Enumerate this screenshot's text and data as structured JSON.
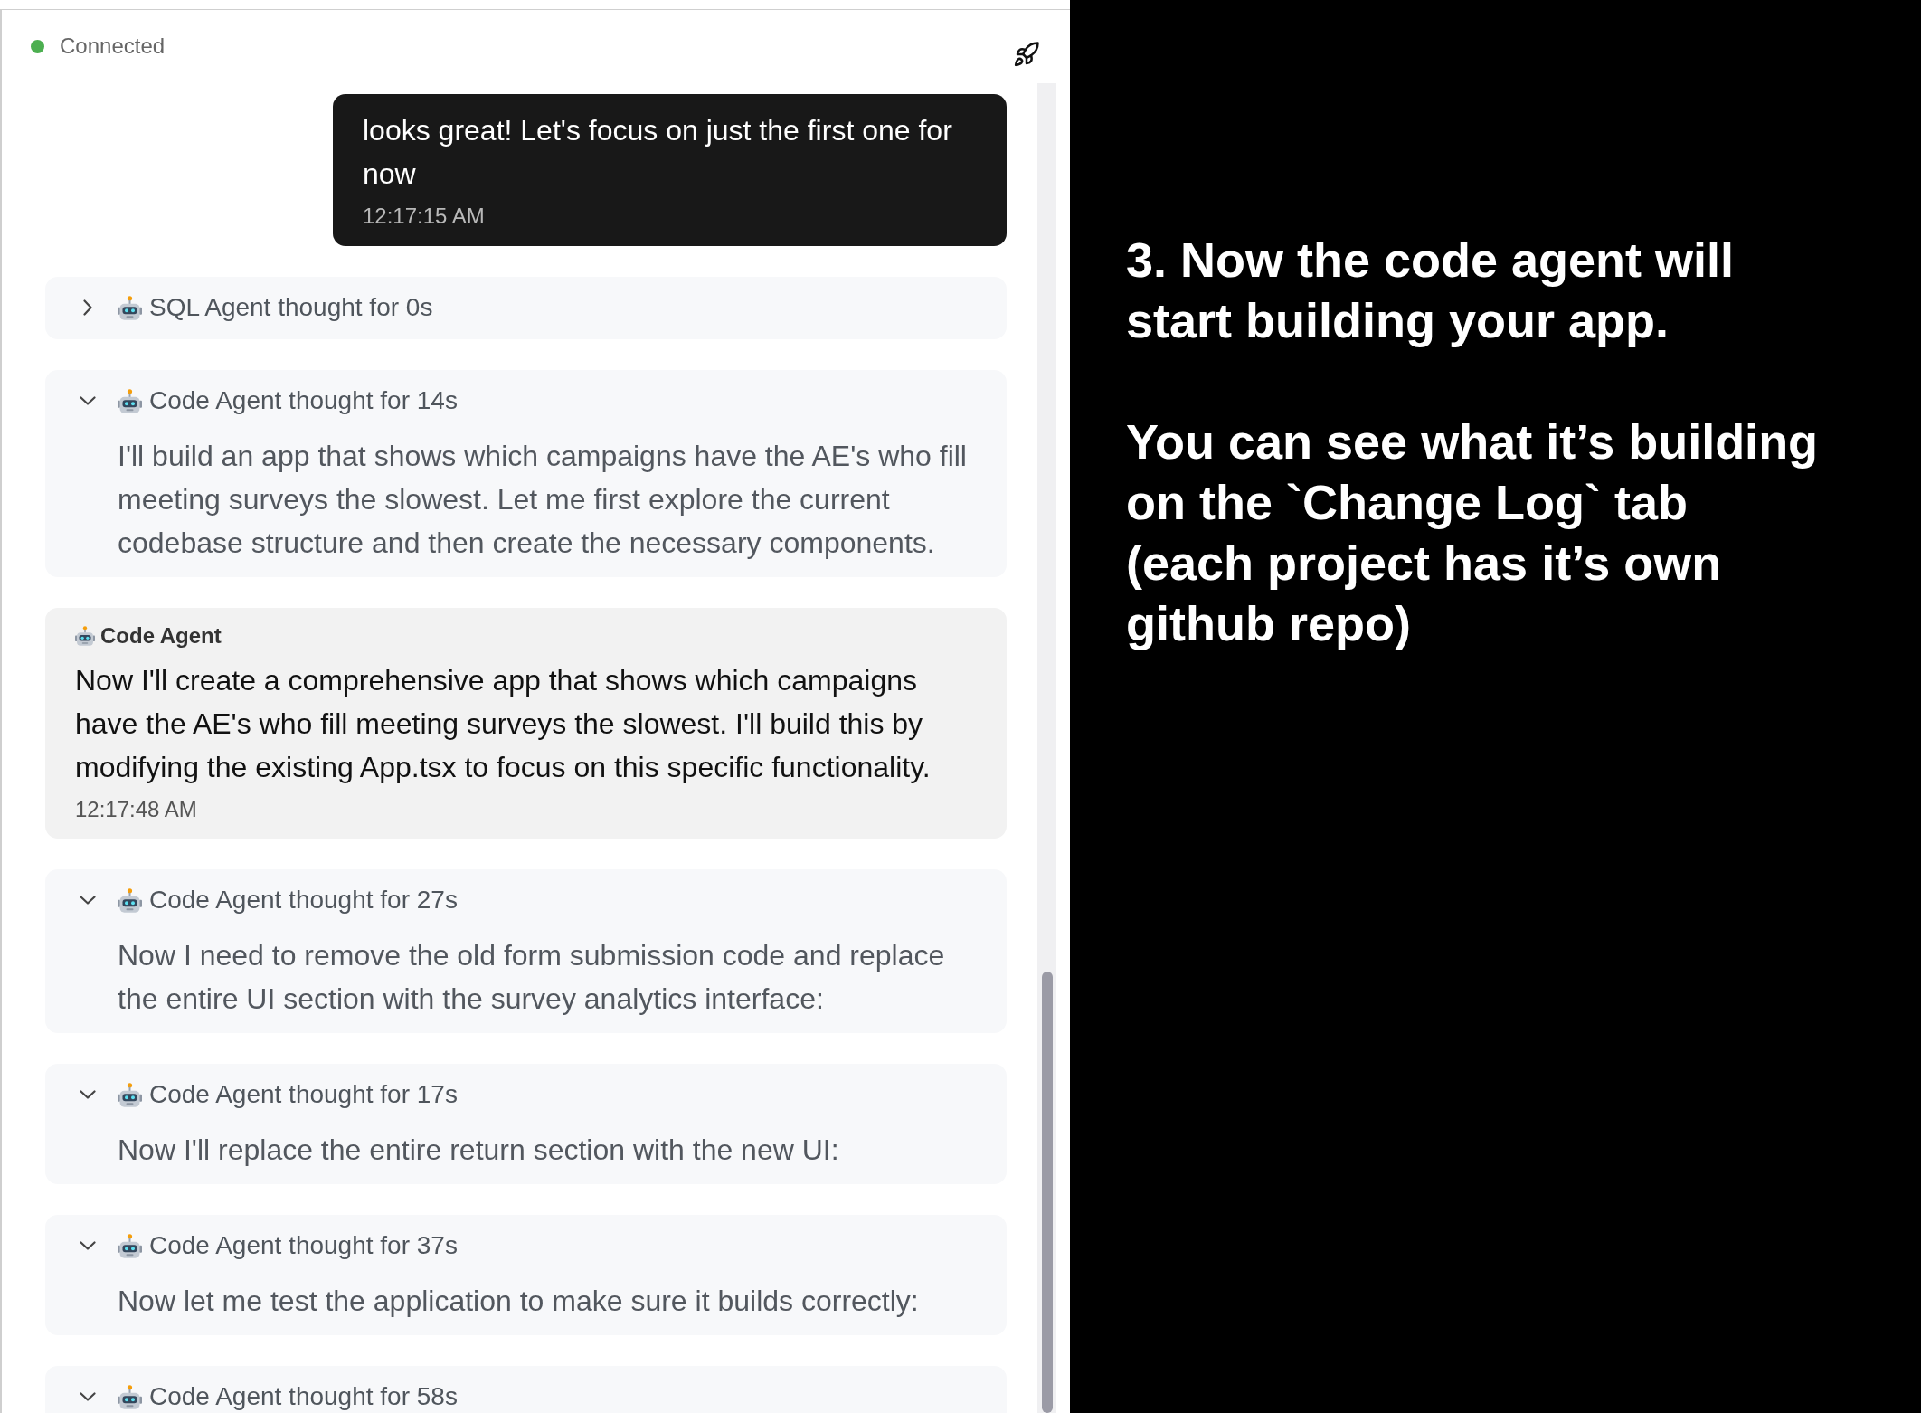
{
  "status": {
    "label": "Connected",
    "connected": true
  },
  "messages": [
    {
      "kind": "user",
      "text": "looks great! Let's focus on just the first one for now",
      "time": "12:17:15 AM"
    },
    {
      "kind": "thought",
      "title": "SQL Agent thought for 0s",
      "expanded": false
    },
    {
      "kind": "thought",
      "title": "Code Agent thought for 14s",
      "expanded": true,
      "text": "I'll build an app that shows which campaigns have the AE's who fill meeting surveys the slowest. Let me first explore the current codebase structure and then create the necessary components."
    },
    {
      "kind": "agent",
      "sender": "Code Agent",
      "text": "Now I'll create a comprehensive app that shows which campaigns have the AE's who fill meeting surveys the slowest. I'll build this by modifying the existing App.tsx to focus on this specific functionality.",
      "time": "12:17:48 AM"
    },
    {
      "kind": "thought",
      "title": "Code Agent thought for 27s",
      "expanded": true,
      "text": "Now I need to remove the old form submission code and replace the entire UI section with the survey analytics interface:"
    },
    {
      "kind": "thought",
      "title": "Code Agent thought for 17s",
      "expanded": true,
      "text": "Now I'll replace the entire return section with the new UI:"
    },
    {
      "kind": "thought",
      "title": "Code Agent thought for 37s",
      "expanded": true,
      "text": "Now let me test the application to make sure it builds correctly:"
    },
    {
      "kind": "thought",
      "title": "Code Agent thought for 58s",
      "expanded": true
    }
  ],
  "caption": {
    "paragraphs": [
      "3. Now the code agent will\nstart building your app.",
      "You can see what it’s building\non the `Change Log` tab\n(each project has it’s own\ngithub repo)"
    ]
  }
}
